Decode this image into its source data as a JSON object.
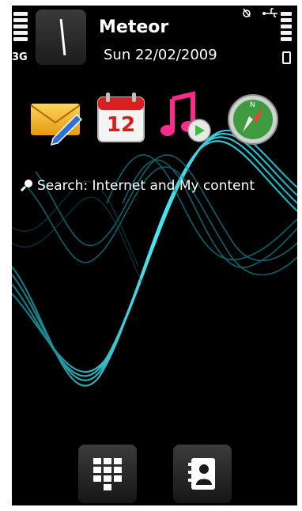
{
  "status_bar": {
    "network_type": "3G",
    "operator": "Meteor",
    "date": "Sun 22/02/2009",
    "signal_icon": "signal-bars-icon",
    "battery_icon": "battery-icon",
    "alarm_icon": "alarm-icon",
    "usb_icon": "usb-icon"
  },
  "shortcuts": [
    {
      "name": "messaging",
      "icon": "mail-icon"
    },
    {
      "name": "calendar",
      "icon": "calendar-icon",
      "day": "12"
    },
    {
      "name": "music",
      "icon": "music-icon"
    },
    {
      "name": "maps",
      "icon": "compass-icon"
    }
  ],
  "search": {
    "label": "Search: Internet and My content"
  },
  "softkeys": [
    {
      "name": "dialer",
      "icon": "keypad-icon"
    },
    {
      "name": "contacts",
      "icon": "contacts-icon"
    }
  ],
  "colors": {
    "background": "#000000",
    "wave_accent": "#35d6e6",
    "text": "#ffffff"
  }
}
